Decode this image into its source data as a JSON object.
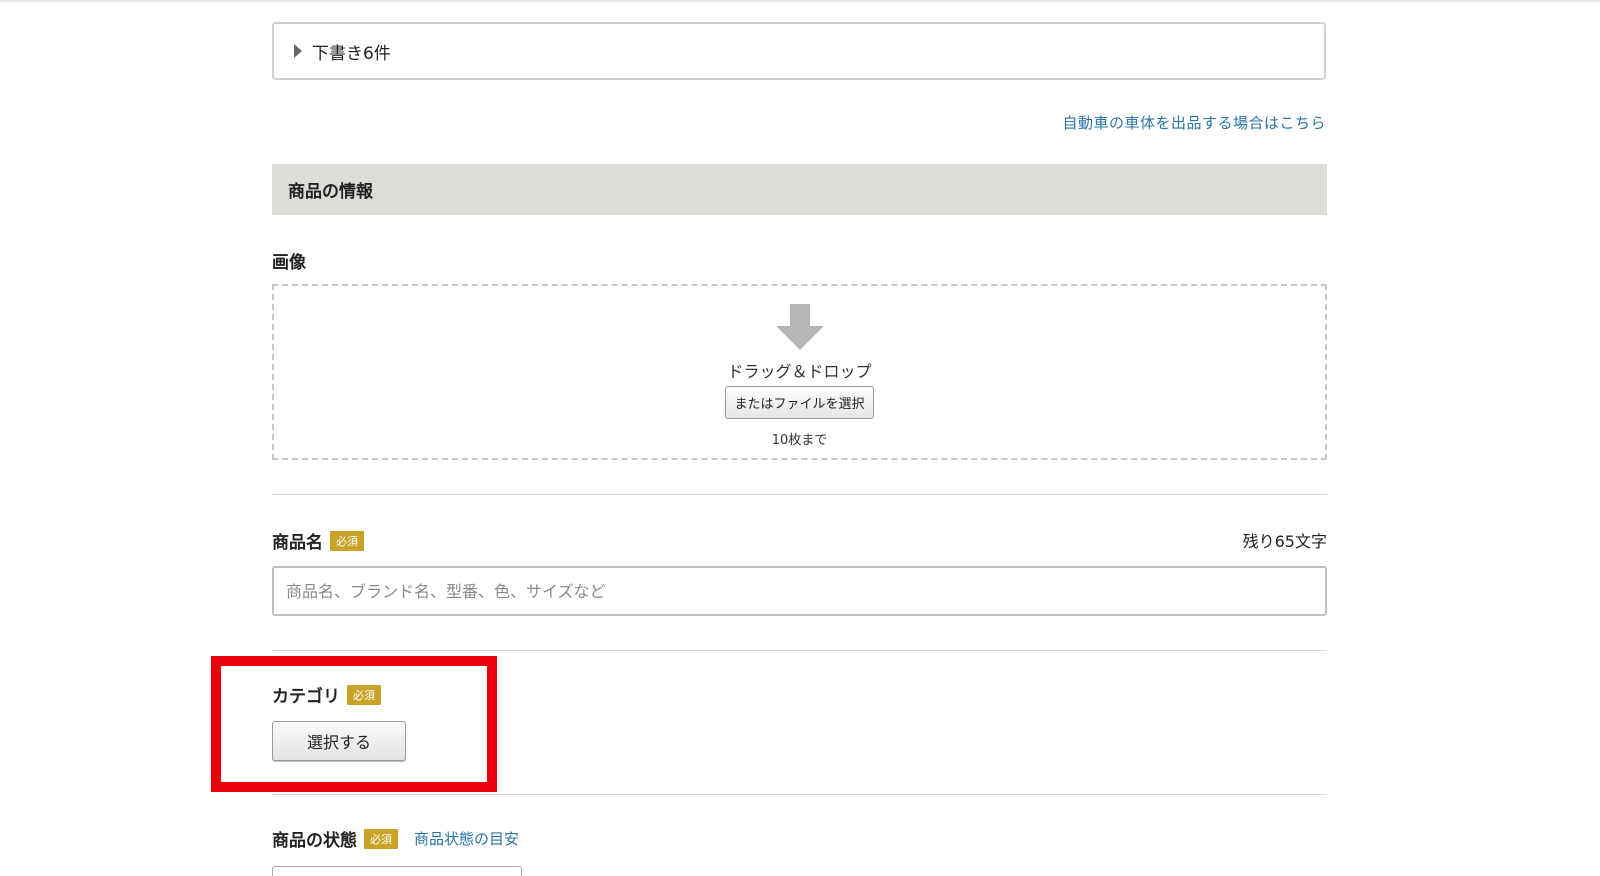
{
  "drafts": {
    "label": "下書き6件"
  },
  "links": {
    "car_body": "自動車の車体を出品する場合はこちら"
  },
  "section": {
    "title": "商品の情報"
  },
  "image": {
    "label": "画像",
    "drop_text": "ドラッグ＆ドロップ",
    "file_button": "またはファイルを選択",
    "limit": "10枚まで"
  },
  "product_name": {
    "label": "商品名",
    "required": "必須",
    "remaining": "残り65文字",
    "placeholder": "商品名、ブランド名、型番、色、サイズなど",
    "value": ""
  },
  "category": {
    "label": "カテゴリ",
    "required": "必須",
    "button": "選択する"
  },
  "condition": {
    "label": "商品の状態",
    "required": "必須",
    "guide_link": "商品状態の目安"
  },
  "colors": {
    "accent_link": "#2b74a8",
    "required_badge": "#c9a227",
    "highlight": "#e8000b"
  }
}
